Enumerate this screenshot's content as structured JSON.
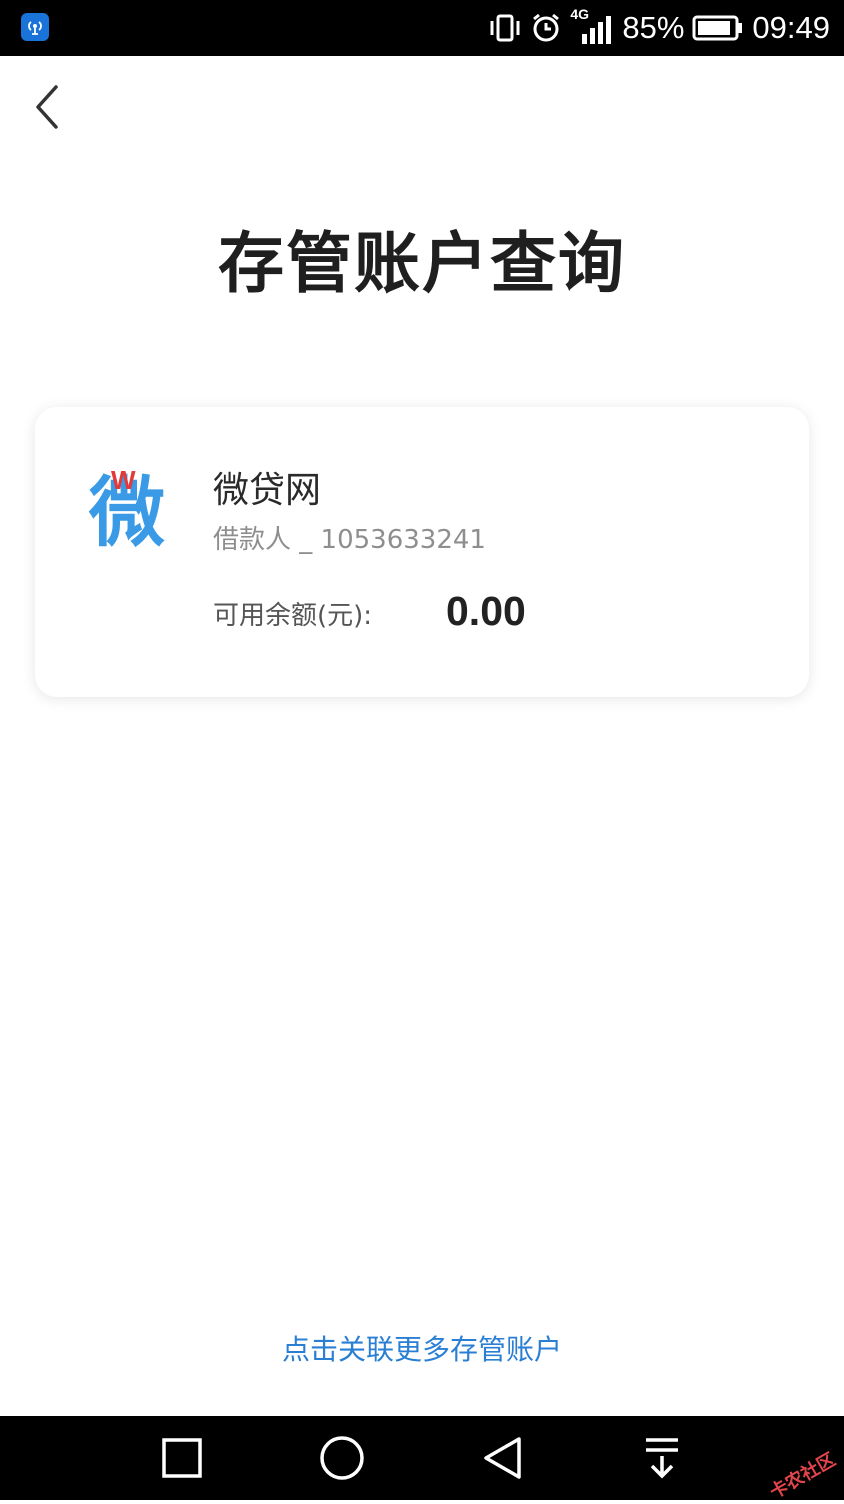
{
  "status_bar": {
    "app_icon": "wifi-bridge-icon",
    "network_type": "4G",
    "battery": "85%",
    "time": "09:49",
    "icons": [
      "vibrate-icon",
      "alarm-icon",
      "signal-icon",
      "battery-icon"
    ]
  },
  "header": {
    "back_icon": "chevron-left-icon",
    "title": "存管账户查询"
  },
  "account_card": {
    "logo_letter": "W",
    "logo_glyph": "微",
    "platform_name": "微贷网",
    "borrower_label": "借款人 _ ",
    "borrower_id": "1053633241",
    "balance_label": "可用余额(元):",
    "balance_value": "0.00"
  },
  "footer": {
    "link_text": "点击关联更多存管账户"
  },
  "nav_bar": {
    "buttons": [
      "recent-apps-icon",
      "home-icon",
      "back-icon",
      "notification-pull-icon"
    ],
    "watermark": "卡农社区"
  },
  "colors": {
    "status_bar_bg": "#000000",
    "title_text": "#1f1f1f",
    "link": "#2a7fd4",
    "logo_blue": "#3a9ae6",
    "logo_red": "#e23a3a",
    "secondary_text": "#8e8e8e"
  }
}
